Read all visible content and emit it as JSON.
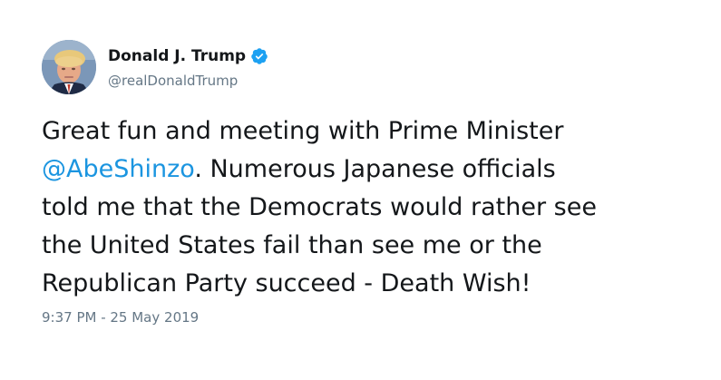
{
  "user": {
    "display_name": "Donald J. Trump",
    "handle": "@realDonaldTrump",
    "verified_icon": "verified-badge-icon",
    "verified_color": "#1da1f2"
  },
  "tweet": {
    "lines": [
      {
        "before": "Great fun and meeting with Prime Minister",
        "mention": "",
        "after": ""
      },
      {
        "before": "",
        "mention": "@AbeShinzo",
        "after": ". Numerous Japanese officials"
      },
      {
        "before": "told me that the Democrats would rather see",
        "mention": "",
        "after": ""
      },
      {
        "before": "the United States fail than see me or the",
        "mention": "",
        "after": ""
      },
      {
        "before": "Republican Party succeed - Death Wish!",
        "mention": "",
        "after": ""
      }
    ],
    "mention_color": "#1b95e0",
    "timestamp": "9:37 PM - 25 May 2019"
  }
}
